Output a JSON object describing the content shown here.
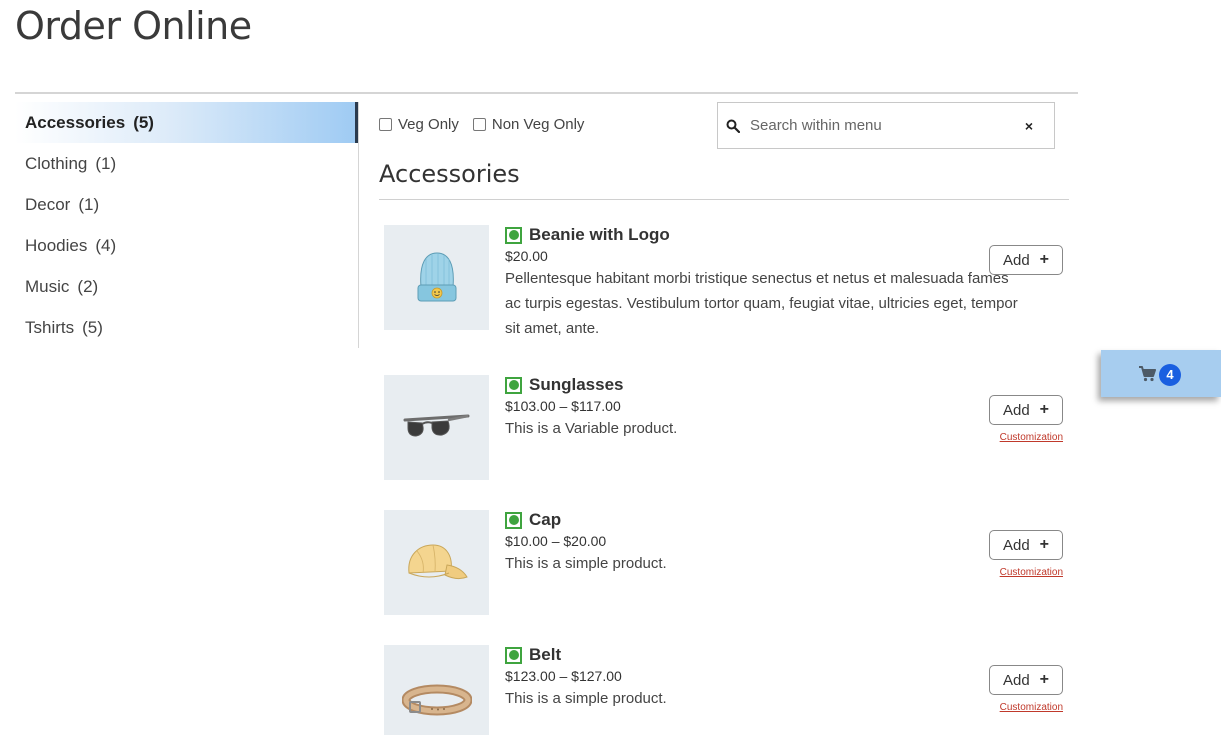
{
  "page": {
    "title": "Order Online"
  },
  "sidebar": {
    "items": [
      {
        "label": "Accessories",
        "count": "(5)",
        "active": true
      },
      {
        "label": "Clothing",
        "count": "(1)"
      },
      {
        "label": "Decor",
        "count": "(1)"
      },
      {
        "label": "Hoodies",
        "count": "(4)"
      },
      {
        "label": "Music",
        "count": "(2)"
      },
      {
        "label": "Tshirts",
        "count": "(5)"
      }
    ]
  },
  "filters": {
    "veg_only": "Veg Only",
    "non_veg_only": "Non Veg Only"
  },
  "search": {
    "placeholder": "Search within menu",
    "clear": "×"
  },
  "section": {
    "title": "Accessories"
  },
  "products": [
    {
      "name": "Beanie with Logo",
      "price": "$20.00",
      "description": "Pellentesque habitant morbi tristique senectus et netus et malesuada fames ac turpis egestas. Vestibulum tortor quam, feugiat vitae, ultricies eget, tempor sit amet, ante.",
      "add_label": "Add",
      "add_plus": "+",
      "customization": "",
      "image": "beanie-image"
    },
    {
      "name": "Sunglasses",
      "price": "$103.00 – $117.00",
      "description": "This is a Variable product.",
      "add_label": "Add",
      "add_plus": "+",
      "customization": "Customization",
      "image": "sunglasses-image"
    },
    {
      "name": "Cap",
      "price": "$10.00 – $20.00",
      "description": "This is a simple product.",
      "add_label": "Add",
      "add_plus": "+",
      "customization": "Customization",
      "image": "cap-image"
    },
    {
      "name": "Belt",
      "price": "$123.00 – $127.00",
      "description": "This is a simple product.",
      "add_label": "Add",
      "add_plus": "+",
      "customization": "Customization",
      "image": "belt-image"
    }
  ],
  "cart": {
    "count": "4",
    "icon": "cart-icon"
  },
  "colors": {
    "accent": "#1a5fe0",
    "veg": "#3fa43f",
    "cart_bg": "#a7cdef",
    "link": "#c0392b"
  }
}
